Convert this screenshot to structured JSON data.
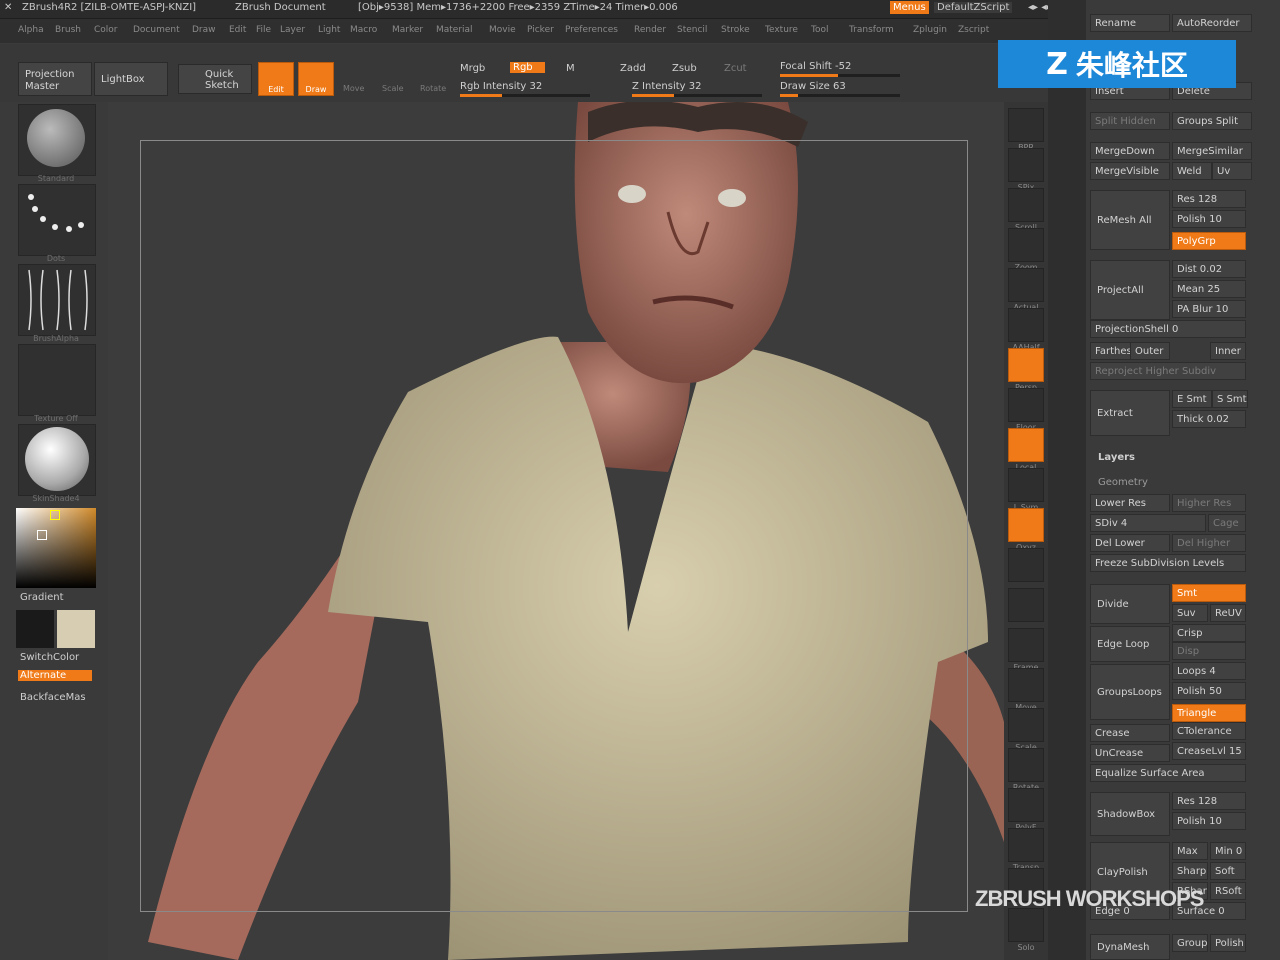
{
  "titlebar": {
    "app": "ZBrush4R2  [ZILB-OMTE-ASPJ-KNZI]",
    "doc": "ZBrush Document",
    "stats": "[Obj▸9538] Mem▸1736+2200  Free▸2359  ZTime▸24  Timer▸0.006",
    "menus_btn": "Menus",
    "script": "DefaultZScript"
  },
  "menubar": [
    "Alpha",
    "Brush",
    "Color",
    "Document",
    "Draw",
    "Edit",
    "File",
    "Layer",
    "Light",
    "Macro",
    "Marker",
    "Material",
    "Movie",
    "Picker",
    "Preferences",
    "Render",
    "Stencil",
    "Stroke",
    "Texture",
    "Tool",
    "Transform",
    "Zplugin",
    "Zscript"
  ],
  "shelf": {
    "projection_master": "Projection Master",
    "lightbox": "LightBox",
    "quick_sketch": "Quick Sketch",
    "edit": "Edit",
    "draw": "Draw",
    "move": "Move",
    "scale": "Scale",
    "rotate": "Rotate",
    "mrgb": "Mrgb",
    "rgb": "Rgb",
    "m": "M",
    "rgb_intensity": "Rgb Intensity 32",
    "zadd": "Zadd",
    "zsub": "Zsub",
    "zcut": "Zcut",
    "z_intensity": "Z Intensity 32",
    "focal_shift": "Focal Shift -52",
    "draw_size": "Draw Size 63",
    "rgb_intensity_value": 0.32,
    "z_intensity_value": 0.32,
    "focal_shift_value": 0.48,
    "draw_size_value": 0.15
  },
  "lefttray": {
    "standard": "Standard",
    "dots": "Dots",
    "brushalpha": "BrushAlpha",
    "texture_off": "Texture Off",
    "skinshade": "SkinShade4",
    "gradient": "Gradient",
    "switchcolor": "SwitchColor",
    "alternate": "Alternate",
    "backfacemask": "BackfaceMas"
  },
  "righttools": [
    "BPR",
    "SPix",
    "Scroll",
    "Zoom",
    "Actual",
    "AAHalf",
    "Persp",
    "Floor",
    "Local",
    "L.Sym",
    "Qxyz",
    "",
    "",
    "Frame",
    "Move",
    "Scale",
    "Rotate",
    "PolyF",
    "Transp",
    "",
    "Solo",
    ""
  ],
  "rightpanel": {
    "top_cut_1": "Rename",
    "top_cut_2": "AutoReorder",
    "insert": "Insert",
    "delete": "Delete",
    "split_hidden": "Split Hidden",
    "groups_split": "Groups Split",
    "mergedown": "MergeDown",
    "mergesimilar": "MergeSimilar",
    "mergevisible": "MergeVisible",
    "weld": "Weld",
    "uv": "Uv",
    "remesh_all": "ReMesh All",
    "res_128": "Res 128",
    "polish_10": "Polish 10",
    "polygrp": "PolyGrp",
    "projectall": "ProjectAll",
    "dist": "Dist 0.02",
    "mean": "Mean 25",
    "pa_blur": "PA Blur 10",
    "projectionshell": "ProjectionShell 0",
    "farthest": "Farthest",
    "outer": "Outer",
    "inner": "Inner",
    "reproject_higher": "Reproject Higher Subdiv",
    "extract": "Extract",
    "e_smt": "E Smt",
    "s_smt": "S Smt",
    "thick": "Thick 0.02",
    "layers": "Layers",
    "geometry": "Geometry",
    "lower_res": "Lower Res",
    "higher_res": "Higher Res",
    "sdiv": "SDiv 4",
    "cage": "Cage",
    "del_lower": "Del Lower",
    "del_higher": "Del Higher",
    "freeze": "Freeze SubDivision Levels",
    "divide": "Divide",
    "smt": "Smt",
    "suv": "Suv",
    "reuv": "ReUV",
    "edge_loop": "Edge Loop",
    "crisp": "Crisp",
    "disp": "Disp",
    "loops": "Loops 4",
    "groupsloops": "GroupsLoops",
    "polish_50": "Polish 50",
    "triangle": "Triangle",
    "crease": "Crease",
    "ctolerance": "CTolerance",
    "uncrease": "UnCrease",
    "creaselvl": "CreaseLvl 15",
    "equalize": "Equalize Surface Area",
    "shadowbox": "ShadowBox",
    "res_128b": "Res 128",
    "polish_10b": "Polish 10",
    "max": "Max",
    "min": "Min 0",
    "claypolish": "ClayPolish",
    "sharp": "Sharp",
    "soft": "Soft",
    "rsharp": "RSharp",
    "rsoft": "RSoft",
    "edge": "Edge 0",
    "surface": "Surface 0",
    "dynamesh": "DynaMesh",
    "group": "Group",
    "polish": "Polish"
  },
  "watermark": "朱峰社区",
  "zbrush_workshops": "ZBRUSH WORKSHOPS",
  "colors": {
    "accent": "#f07a17",
    "panel": "#3a3a3a",
    "viewport": "#3c3c3c",
    "skin": "#b07a6a",
    "shirt": "#cfc4a0"
  }
}
